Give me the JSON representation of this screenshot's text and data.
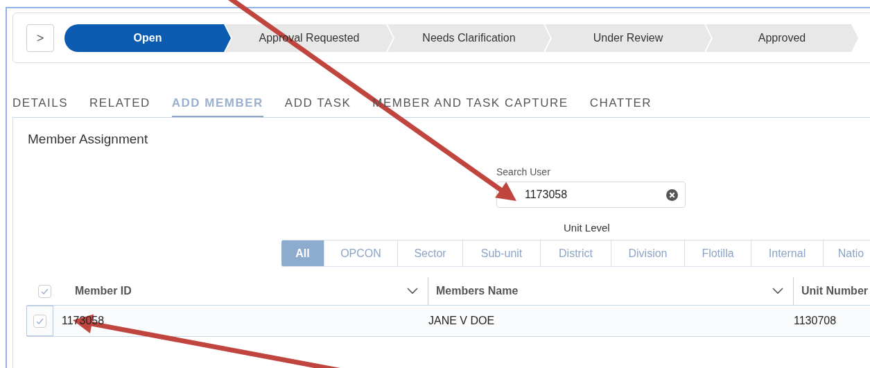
{
  "path": {
    "toggle": ">",
    "stages": [
      {
        "label": "Open",
        "selected": true
      },
      {
        "label": "Approval Requested",
        "selected": false
      },
      {
        "label": "Needs Clarification",
        "selected": false
      },
      {
        "label": "Under Review",
        "selected": false
      },
      {
        "label": "Approved",
        "selected": false
      }
    ]
  },
  "tabs": [
    {
      "label": "DETAILS",
      "selected": false
    },
    {
      "label": "RELATED",
      "selected": false
    },
    {
      "label": "ADD MEMBER",
      "selected": true
    },
    {
      "label": "ADD TASK",
      "selected": false
    },
    {
      "label": "MEMBER AND TASK CAPTURE",
      "selected": false
    },
    {
      "label": "CHATTER",
      "selected": false
    }
  ],
  "panel": {
    "title": "Member Assignment",
    "search": {
      "label": "Search User",
      "value": "1173058"
    },
    "unit_level": {
      "label": "Unit Level",
      "options": [
        {
          "label": "All",
          "selected": true
        },
        {
          "label": "OPCON",
          "selected": false
        },
        {
          "label": "Sector",
          "selected": false
        },
        {
          "label": "Sub-unit",
          "selected": false
        },
        {
          "label": "District",
          "selected": false
        },
        {
          "label": "Division",
          "selected": false
        },
        {
          "label": "Flotilla",
          "selected": false
        },
        {
          "label": "Internal",
          "selected": false
        },
        {
          "label": "Natio",
          "selected": false
        }
      ]
    },
    "table": {
      "all_checked": true,
      "columns": [
        "Member ID",
        "Members Name",
        "Unit Number"
      ],
      "rows": [
        {
          "checked": true,
          "cells": [
            "1173058",
            "JANE V DOE",
            "1130708"
          ]
        }
      ]
    }
  },
  "annotations": [
    {
      "kind": "arrow"
    },
    {
      "kind": "arrow"
    }
  ]
}
